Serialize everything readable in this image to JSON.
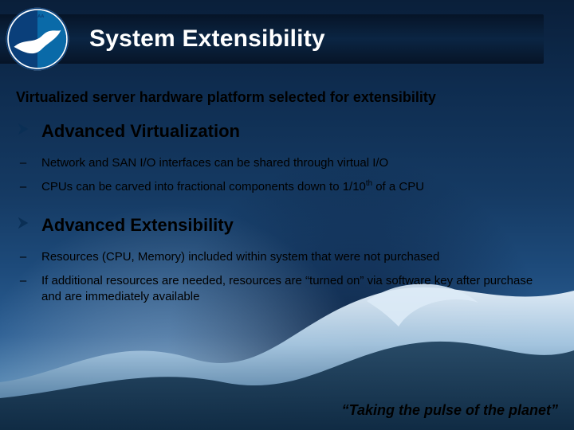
{
  "title": "System Extensibility",
  "subtitle": "Virtualized server hardware platform selected for extensibility",
  "sections": [
    {
      "heading": "Advanced Virtualization",
      "bullets": [
        "Network and SAN I/O interfaces can be shared through virtual I/O",
        "CPUs can be carved into fractional components down to 1/10th of a CPU"
      ]
    },
    {
      "heading": "Advanced Extensibility",
      "bullets": [
        "Resources (CPU, Memory) included within system that were not purchased",
        "If additional resources are needed, resources are “turned on” via software key after purchase and are immediately available"
      ]
    }
  ],
  "tagline": "“Taking the pulse of the planet”",
  "logo_label": "NOAA"
}
